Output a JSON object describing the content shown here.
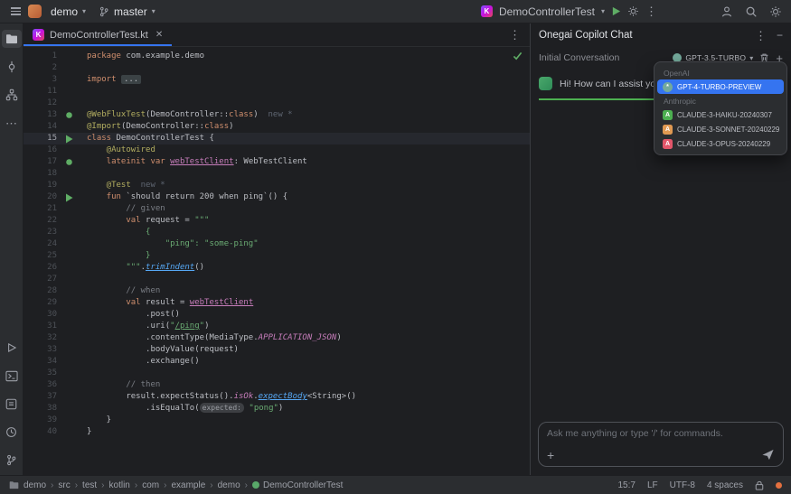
{
  "titlebar": {
    "project": "demo",
    "branch": "master",
    "run_config": "DemoControllerTest"
  },
  "tabbar": {
    "tabs": [
      {
        "label": "DemoControllerTest.kt"
      }
    ]
  },
  "editor": {
    "lines": [
      {
        "n": "1",
        "tokens": [
          [
            "kw",
            "package"
          ],
          [
            "pl",
            " com.example.demo"
          ]
        ]
      },
      {
        "n": "2",
        "tokens": []
      },
      {
        "n": "3",
        "tokens": [
          [
            "kw",
            "import"
          ],
          [
            "pl",
            " "
          ],
          [
            "fold",
            "..."
          ]
        ]
      },
      {
        "n": "11",
        "tokens": []
      },
      {
        "n": "12",
        "tokens": []
      },
      {
        "n": "13",
        "icon": "bean",
        "tokens": [
          [
            "ann",
            "@WebFluxTest"
          ],
          [
            "pl",
            "(DemoController::"
          ],
          [
            "kw",
            "class"
          ],
          [
            "pl",
            ")"
          ],
          [
            "hint",
            "  new *"
          ]
        ]
      },
      {
        "n": "14",
        "tokens": [
          [
            "ann",
            "@Import"
          ],
          [
            "pl",
            "(DemoController::"
          ],
          [
            "kw",
            "class"
          ],
          [
            "pl",
            ")"
          ]
        ]
      },
      {
        "n": "15",
        "icon": "run",
        "hl": true,
        "tokens": [
          [
            "kw",
            "class"
          ],
          [
            "pl",
            " DemoControllerTest {"
          ]
        ]
      },
      {
        "n": "16",
        "tokens": [
          [
            "ann",
            "    @Autowired"
          ]
        ]
      },
      {
        "n": "17",
        "icon": "bean",
        "tokens": [
          [
            "kw",
            "    lateinit var"
          ],
          [
            "pl",
            " "
          ],
          [
            "prop",
            "webTestClient"
          ],
          [
            "pl",
            ": WebTestClient"
          ]
        ]
      },
      {
        "n": "18",
        "tokens": []
      },
      {
        "n": "19",
        "tokens": [
          [
            "ann",
            "    @Test"
          ],
          [
            "hint",
            "  new *"
          ]
        ]
      },
      {
        "n": "20",
        "icon": "run",
        "tokens": [
          [
            "kw",
            "    fun"
          ],
          [
            "pl",
            " `should return 200 when ping`() {"
          ]
        ]
      },
      {
        "n": "21",
        "tokens": [
          [
            "cm",
            "        // given"
          ]
        ]
      },
      {
        "n": "22",
        "tokens": [
          [
            "kw",
            "        val"
          ],
          [
            "pl",
            " request = "
          ],
          [
            "str",
            "\"\"\""
          ]
        ]
      },
      {
        "n": "23",
        "tokens": [
          [
            "str",
            "            {"
          ]
        ]
      },
      {
        "n": "24",
        "tokens": [
          [
            "str",
            "                \"ping\": \"some-ping\""
          ]
        ]
      },
      {
        "n": "25",
        "tokens": [
          [
            "str",
            "            }"
          ]
        ]
      },
      {
        "n": "26",
        "tokens": [
          [
            "str",
            "        \"\"\""
          ],
          [
            "pl",
            "."
          ],
          [
            "ext",
            "trimIndent"
          ],
          [
            "pl",
            "()"
          ]
        ]
      },
      {
        "n": "27",
        "tokens": []
      },
      {
        "n": "28",
        "tokens": [
          [
            "cm",
            "        // when"
          ]
        ]
      },
      {
        "n": "29",
        "tokens": [
          [
            "kw",
            "        val"
          ],
          [
            "pl",
            " result = "
          ],
          [
            "prop",
            "webTestClient"
          ]
        ]
      },
      {
        "n": "30",
        "tokens": [
          [
            "pl",
            "            .post()"
          ]
        ]
      },
      {
        "n": "31",
        "tokens": [
          [
            "pl",
            "            .uri("
          ],
          [
            "str",
            "\""
          ],
          [
            "strl",
            "/ping"
          ],
          [
            "str",
            "\""
          ],
          [
            "pl",
            ")"
          ]
        ]
      },
      {
        "n": "32",
        "tokens": [
          [
            "pl",
            "            .contentType(MediaType."
          ],
          [
            "const",
            "APPLICATION_JSON"
          ],
          [
            "pl",
            ")"
          ]
        ]
      },
      {
        "n": "33",
        "tokens": [
          [
            "pl",
            "            .bodyValue(request)"
          ]
        ]
      },
      {
        "n": "34",
        "tokens": [
          [
            "pl",
            "            .exchange()"
          ]
        ]
      },
      {
        "n": "35",
        "tokens": []
      },
      {
        "n": "36",
        "tokens": [
          [
            "cm",
            "        // then"
          ]
        ]
      },
      {
        "n": "37",
        "tokens": [
          [
            "pl",
            "        result.expectStatus()."
          ],
          [
            "const",
            "isOk"
          ],
          [
            "pl",
            "."
          ],
          [
            "ext",
            "expectBody"
          ],
          [
            "pl",
            "<String>()"
          ]
        ]
      },
      {
        "n": "38",
        "tokens": [
          [
            "pl",
            "            .isEqualTo("
          ],
          [
            "chip",
            "expected:"
          ],
          [
            "pl",
            " "
          ],
          [
            "str",
            "\"pong\""
          ],
          [
            "pl",
            ")"
          ]
        ]
      },
      {
        "n": "39",
        "tokens": [
          [
            "pl",
            "    }"
          ]
        ]
      },
      {
        "n": "40",
        "tokens": [
          [
            "pl",
            "}"
          ]
        ]
      }
    ]
  },
  "chat": {
    "title": "Onegai Copilot Chat",
    "conversation_label": "Initial Conversation",
    "model_selector": {
      "label": "GPT-3.5-TURBO"
    },
    "assistant_message": "Hi! How can I assist you today?",
    "input": {
      "placeholder": "Ask me anything or type '/' for commands."
    },
    "dropdown": {
      "groups": [
        {
          "label": "OpenAI",
          "items": [
            {
              "label": "GPT-4-TURBO-PREVIEW",
              "icon": "openai-icon",
              "selected": true
            }
          ]
        },
        {
          "label": "Anthropic",
          "items": [
            {
              "label": "CLAUDE-3-HAIKU-20240307",
              "icon": "anthropic-haiku-icon",
              "color": "#4caf50"
            },
            {
              "label": "CLAUDE-3-SONNET-20240229",
              "icon": "anthropic-sonnet-icon",
              "color": "#e09952"
            },
            {
              "label": "CLAUDE-3-OPUS-20240229",
              "icon": "anthropic-opus-icon",
              "color": "#e2566a"
            }
          ]
        }
      ]
    }
  },
  "statusbar": {
    "breadcrumbs": [
      "demo",
      "src",
      "test",
      "kotlin",
      "com",
      "example",
      "demo",
      "DemoControllerTest"
    ],
    "caret": "15:7",
    "line_separator": "LF",
    "encoding": "UTF-8",
    "indent": "4 spaces"
  },
  "activity_bar": {
    "top_icons": [
      "project-icon",
      "commit-icon",
      "structure-icon",
      "more-icon"
    ],
    "bottom_icons": [
      "run-icon",
      "terminal-icon",
      "problems-icon",
      "services-icon",
      "git-icon"
    ]
  },
  "colors": {
    "accent_blue": "#3574f0",
    "run_green": "#5fad65",
    "string_green": "#6aab73",
    "keyword_orange": "#cf8e6d",
    "annotation_yellow": "#b3ae60",
    "message_divider_green": "#4db151",
    "notification_orange": "#e3703f"
  }
}
